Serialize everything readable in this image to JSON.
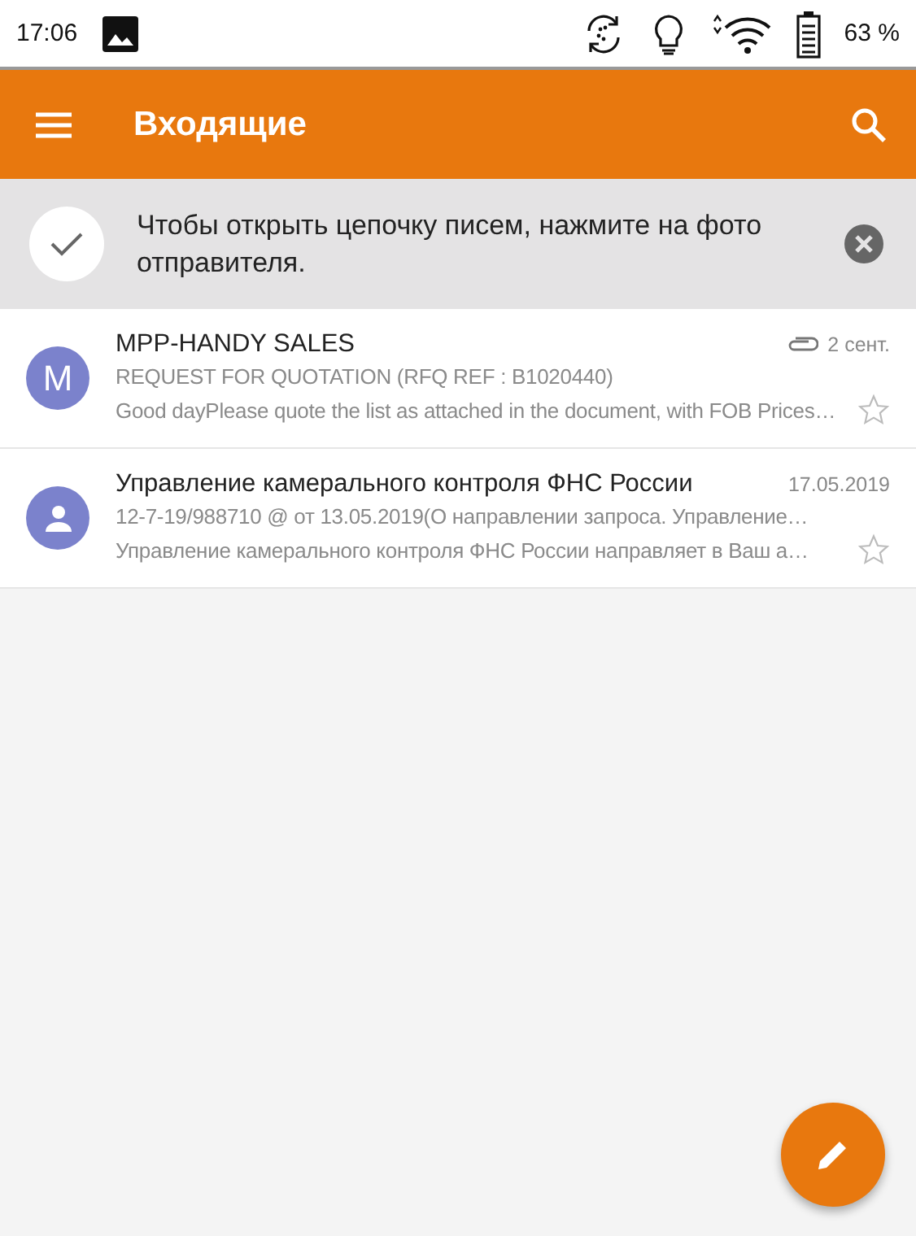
{
  "status_bar": {
    "time": "17:06",
    "battery": "63 %"
  },
  "toolbar": {
    "title": "Входящие"
  },
  "banner": {
    "text": "Чтобы открыть цепочку писем, нажмите на фото отправителя."
  },
  "emails": [
    {
      "avatar": {
        "kind": "letter",
        "letter": "M"
      },
      "sender": "MPP-HANDY SALES",
      "date": "2 сент.",
      "attachment": true,
      "subject": "REQUEST FOR QUOTATION (RFQ REF : B1020440)",
      "preview": "Good dayPlease quote the list as attached in the document, with FOB Prices…",
      "starred": false
    },
    {
      "avatar": {
        "kind": "person"
      },
      "sender": "Управление камерального контроля ФНС России",
      "date": "17.05.2019",
      "attachment": false,
      "subject": "12-7-19/988710 @ от 13.05.2019(О направлении запроса. Управление…",
      "preview": "Управление камерального контроля ФНС России направляет в Ваш а…",
      "starred": false
    }
  ]
}
